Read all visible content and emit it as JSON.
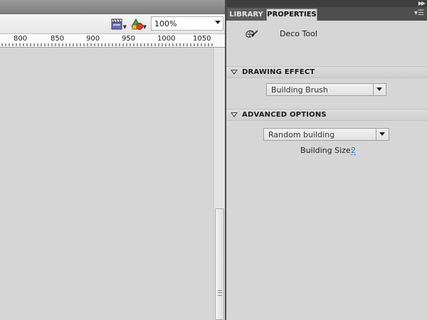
{
  "stage": {
    "zoom_value": "100%",
    "ruler_labels": [
      "800",
      "850",
      "900",
      "950",
      "1000",
      "1050"
    ],
    "icons": [
      "edit-scene-icon",
      "edit-symbols-icon"
    ]
  },
  "panel": {
    "tabs": [
      {
        "label": "LIBRARY",
        "active": false
      },
      {
        "label": "PROPERTIES",
        "active": true
      }
    ],
    "tool": {
      "name": "Deco Tool",
      "icon": "deco-tool-icon"
    },
    "drawing_effect": {
      "header": "DRAWING EFFECT",
      "selected": "Building Brush"
    },
    "advanced_options": {
      "header": "ADVANCED OPTIONS",
      "selected": "Random building",
      "building_size_label": "Building Size:",
      "building_size_value": "2"
    }
  },
  "colors": {
    "panel_bg": "#d6d6d6",
    "tab_strip": "#4e4e4e",
    "link_value": "#2a7bd0"
  }
}
